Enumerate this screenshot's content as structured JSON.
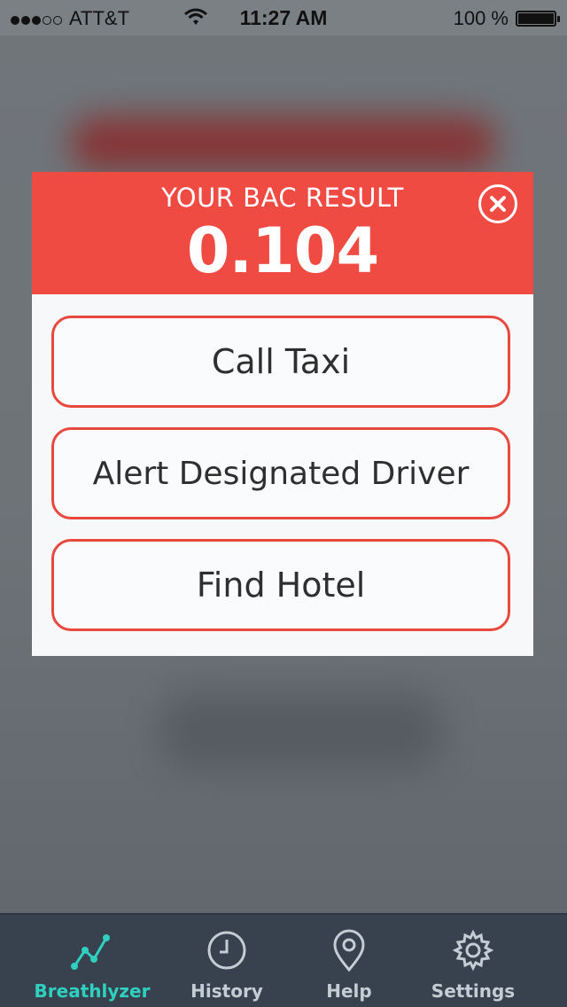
{
  "status_bar": {
    "carrier": "ATT&T",
    "time": "11:27 AM",
    "battery": "100 %"
  },
  "modal": {
    "title": "YOUR BAC RESULT",
    "bac_value": "0.104",
    "buttons": {
      "taxi": "Call Taxi",
      "driver": "Alert Designated Driver",
      "hotel": "Find Hotel"
    }
  },
  "tab_bar": {
    "tabs": [
      {
        "label": "Breathlyzer",
        "icon": "graph-icon",
        "active": true
      },
      {
        "label": "History",
        "icon": "clock-icon",
        "active": false
      },
      {
        "label": "Help",
        "icon": "location-pin-icon",
        "active": false
      },
      {
        "label": "Settings",
        "icon": "gear-icon",
        "active": false
      }
    ]
  },
  "colors": {
    "accent_red": "#f04b43",
    "active_tab": "#2fd0c0",
    "tab_bar_bg": "#38424f"
  }
}
